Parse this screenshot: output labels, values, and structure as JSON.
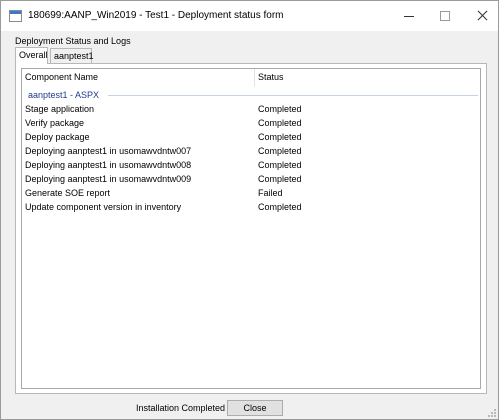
{
  "window": {
    "title": "180699:AANP_Win2019 - Test1 - Deployment status form"
  },
  "group_label": "Deployment Status and Logs",
  "tabs": [
    {
      "label": "Overall",
      "active": true
    },
    {
      "label": "aanptest1",
      "active": false
    }
  ],
  "list": {
    "columns": [
      "Component Name",
      "Status"
    ],
    "group": "aanptest1 - ASPX",
    "rows": [
      {
        "name": "Stage application",
        "status": "Completed"
      },
      {
        "name": "Verify package",
        "status": "Completed"
      },
      {
        "name": "Deploy package",
        "status": "Completed"
      },
      {
        "name": "Deploying aanptest1 in usomawvdntw007",
        "status": "Completed"
      },
      {
        "name": "Deploying aanptest1 in usomawvdntw008",
        "status": "Completed"
      },
      {
        "name": "Deploying aanptest1 in usomawvdntw009",
        "status": "Completed"
      },
      {
        "name": "Generate SOE report",
        "status": "Failed"
      },
      {
        "name": "Update component version in inventory",
        "status": "Completed"
      }
    ]
  },
  "footer": {
    "status_text": "Installation Completed",
    "close_label": "Close"
  },
  "icons": {
    "app": "form-window-icon",
    "minimize": "minimize-icon",
    "maximize": "maximize-icon",
    "close": "close-icon"
  }
}
